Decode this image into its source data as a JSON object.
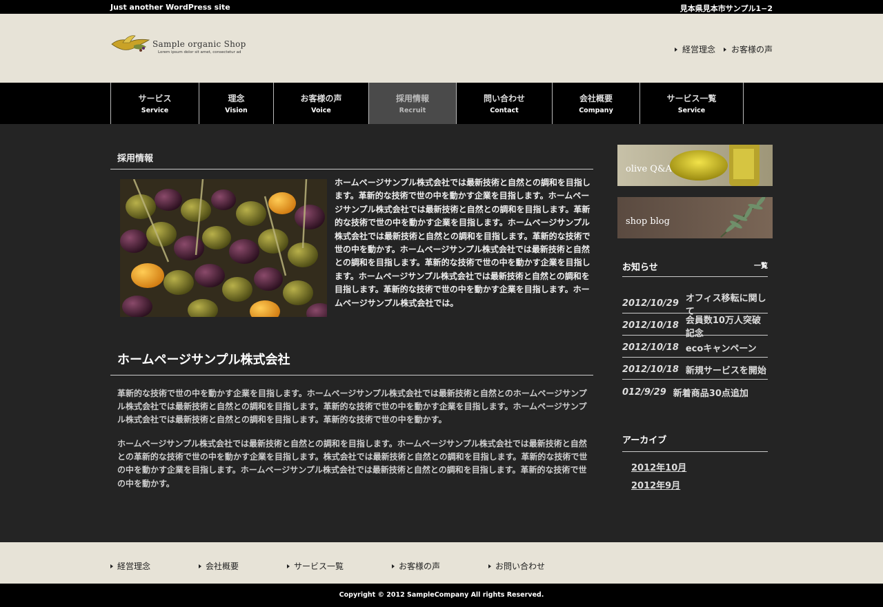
{
  "topbar": {
    "tagline": "Just another WordPress site",
    "address": "見本県見本市サンプル1−2"
  },
  "logo": {
    "name": "Sample organic Shop",
    "subtitle": "Lorem ipsum dolor sit amet, consectetur ad"
  },
  "header_links": [
    {
      "label": "経営理念"
    },
    {
      "label": "お客様の声"
    }
  ],
  "global_nav": [
    {
      "ja": "サービス",
      "en": "Service"
    },
    {
      "ja": "理念",
      "en": "Vision"
    },
    {
      "ja": "お客様の声",
      "en": "Voice"
    },
    {
      "ja": "採用情報",
      "en": "Recruit",
      "active": true
    },
    {
      "ja": "問い合わせ",
      "en": "Contact"
    },
    {
      "ja": "会社概要",
      "en": "Company"
    },
    {
      "ja": "サービス一覧",
      "en": "Service"
    }
  ],
  "main": {
    "page_title": "採用情報",
    "intro_text": "ホームページサンプル株式会社では最新技術と自然との調和を目指します。革新的な技術で世の中を動かす企業を目指します。ホームページサンプル株式会社では最新技術と自然との調和を目指します。革新的な技術で世の中を動かす企業を目指します。ホームページサンプル株式会社では最新技術と自然との調和を目指します。革新的な技術で世の中を動かす。ホームページサンプル株式会社では最新技術と自然との調和を目指します。革新的な技術で世の中を動かす企業を目指します。ホームページサンプル株式会社では最新技術と自然との調和を目指します。革新的な技術で世の中を動かす企業を目指します。ホームページサンプル株式会社では。",
    "heading": "ホームページサンプル株式会社",
    "para1": "革新的な技術で世の中を動かす企業を目指します。ホームページサンプル株式会社では最新技術と自然とのホームページサンプル株式会社では最新技術と自然との調和を目指します。革新的な技術で世の中を動かす企業を目指します。ホームページサンプル株式会社では最新技術と自然との調和を目指します。革新的な技術で世の中を動かす。",
    "para2": "ホームページサンプル株式会社では最新技術と自然との調和を目指します。ホームページサンプル株式会社では最新技術と自然との革新的な技術で世の中を動かす企業を目指します。株式会社では最新技術と自然との調和を目指します。革新的な技術で世の中を動かす企業を目指します。ホームページサンプル株式会社では最新技術と自然との調和を目指します。革新的な技術で世の中を動かす。"
  },
  "sidebar": {
    "banner1": "olive Q&A",
    "banner2": "shop blog",
    "news_title": "お知らせ",
    "news_more": "一覧",
    "news": [
      {
        "date": "2012/10/29",
        "text": "オフィス移転に関して"
      },
      {
        "date": "2012/10/18",
        "text": "会員数10万人突破記念"
      },
      {
        "date": "2012/10/18",
        "text": "ecoキャンペーン"
      },
      {
        "date": "2012/10/18",
        "text": "新規サービスを開始"
      },
      {
        "date": "012/9/29",
        "text": "新着商品30点追加"
      }
    ],
    "archive_title": "アーカイブ",
    "archives": [
      {
        "label": "2012年10月"
      },
      {
        "label": "2012年9月"
      }
    ]
  },
  "footer_links": [
    {
      "label": "経営理念"
    },
    {
      "label": "会社概要"
    },
    {
      "label": "サービス一覧"
    },
    {
      "label": "お客様の声"
    },
    {
      "label": "お問い合わせ"
    }
  ],
  "copyright": "Copyright © 2012 SampleCompany All rights Reserved."
}
